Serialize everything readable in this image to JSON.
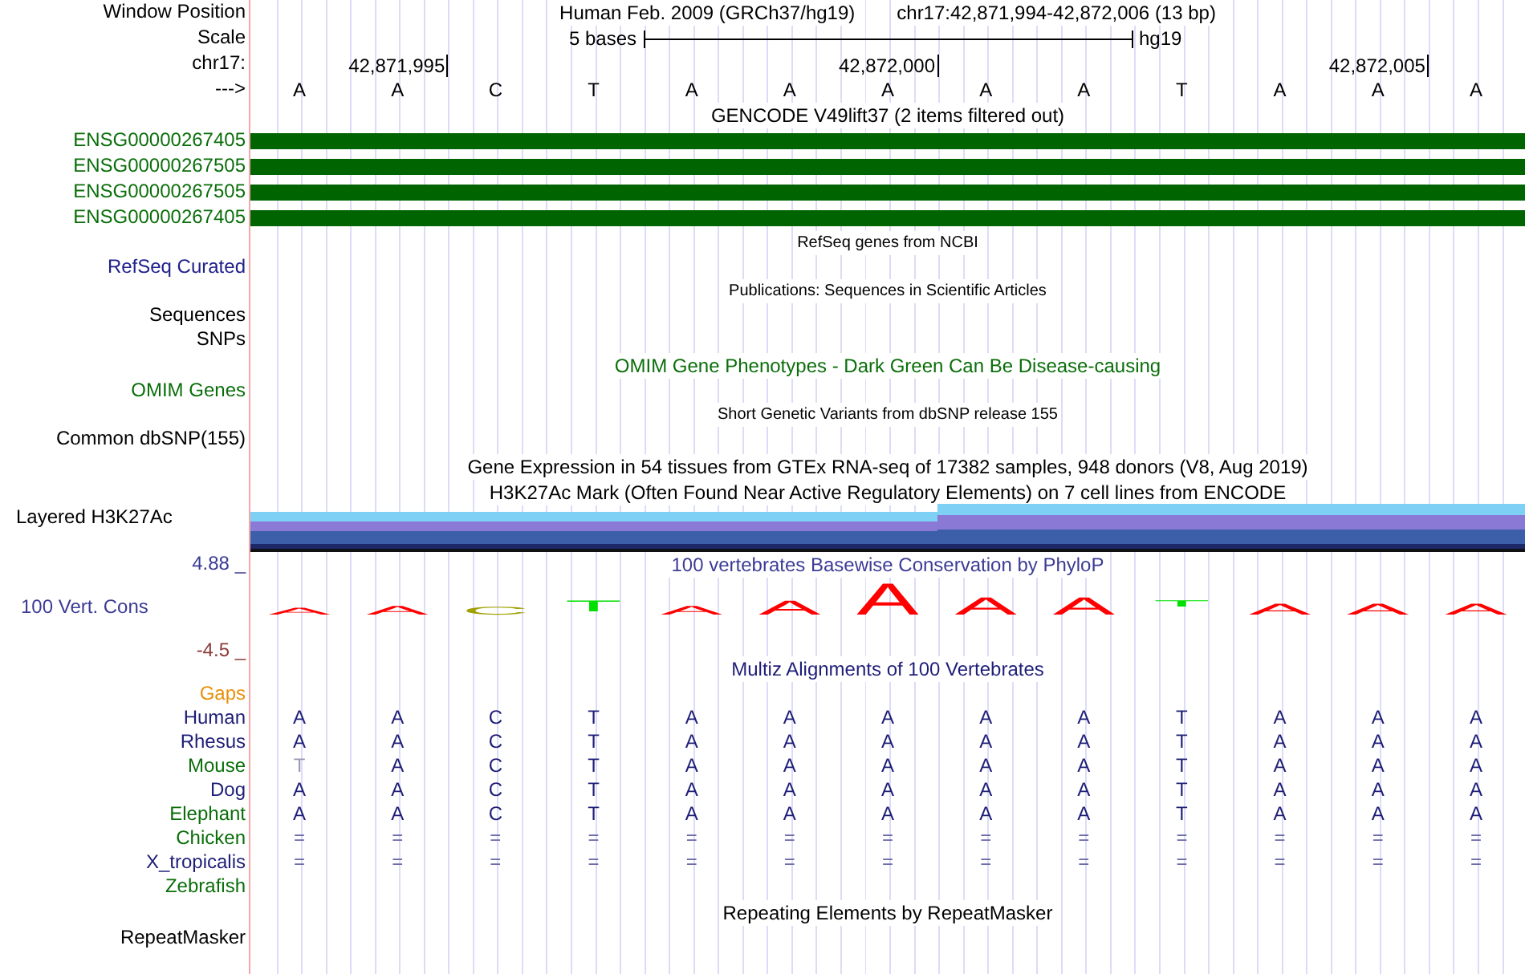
{
  "window_position": {
    "label": "Window Position",
    "assembly": "Human Feb. 2009 (GRCh37/hg19)",
    "position": "chr17:42,871,994-42,872,006 (13 bp)"
  },
  "scale": {
    "label": "Scale",
    "length": "5 bases",
    "assembly": "hg19"
  },
  "ruler": {
    "label": "chr17:",
    "ticks": [
      "42,871,995",
      "42,872,000",
      "42,872,005"
    ],
    "strand": "--->",
    "bases": [
      "A",
      "A",
      "C",
      "T",
      "A",
      "A",
      "A",
      "A",
      "A",
      "T",
      "A",
      "A",
      "A"
    ]
  },
  "tracks": [
    {
      "kind": "genes",
      "title": "GENCODE V49lift37 (2 items filtered out)",
      "color": "#000000",
      "items": [
        {
          "name": "ENSG00000267405"
        },
        {
          "name": "ENSG00000267505"
        },
        {
          "name": "ENSG00000267505"
        },
        {
          "name": "ENSG00000267405"
        }
      ]
    },
    {
      "kind": "compact",
      "title": "RefSeq genes from NCBI",
      "color": "#000000",
      "labels": [
        {
          "text": "RefSeq Curated",
          "color": "#20208c"
        }
      ]
    },
    {
      "kind": "compact",
      "title": "Publications: Sequences in Scientific Articles",
      "color": "#000000",
      "labels": [
        {
          "text": "Sequences",
          "color": "#000000"
        },
        {
          "text": "SNPs",
          "color": "#000000"
        }
      ]
    },
    {
      "kind": "track",
      "title": "OMIM Gene Phenotypes - Dark Green Can Be Disease-causing",
      "color": "#0a6e0a",
      "labels": [
        {
          "text": "OMIM Genes",
          "color": "#0a6e0a"
        }
      ]
    },
    {
      "kind": "compact",
      "title": "Short Genetic Variants from dbSNP release 155",
      "color": "#000000",
      "labels": [
        {
          "text": "Common dbSNP(155)",
          "color": "#000000"
        }
      ]
    },
    {
      "kind": "title",
      "title": "Gene Expression in 54 tissues from GTEx RNA-seq of 17382 samples, 948 donors (V8, Aug 2019)",
      "color": "#000000"
    },
    {
      "kind": "layered",
      "title": "H3K27Ac Mark (Often Found Near Active Regulatory Elements) on 7 cell lines from ENCODE",
      "color": "#000000",
      "label": "Layered H3K27Ac"
    },
    {
      "kind": "conservation",
      "title": "100 vertebrates Basewise Conservation by PhyloP",
      "color": "#3c3c96",
      "label": "100 Vert. Cons",
      "max": "4.88 _",
      "min": "-4.5 _",
      "logo": [
        {
          "letter": "A",
          "color": "#ff0000"
        },
        {
          "letter": "A",
          "color": "#ff0000"
        },
        {
          "letter": "C",
          "color": "#a0a000"
        },
        {
          "letter": "T",
          "color": "#00e000"
        },
        {
          "letter": "A",
          "color": "#ff0000"
        },
        {
          "letter": "A",
          "color": "#ff0000"
        },
        {
          "letter": "A",
          "color": "#ff0000"
        },
        {
          "letter": "A",
          "color": "#ff0000"
        },
        {
          "letter": "A",
          "color": "#ff0000"
        },
        {
          "letter": "T",
          "color": "#00e000"
        },
        {
          "letter": "A",
          "color": "#ff0000"
        },
        {
          "letter": "A",
          "color": "#ff0000"
        },
        {
          "letter": "A",
          "color": "#ff0000"
        }
      ]
    },
    {
      "kind": "alignment",
      "title": "Multiz Alignments of 100 Vertebrates",
      "color": "#1e1e78",
      "rows": [
        {
          "name": "Gaps",
          "color": "#e8900a",
          "kind": "label"
        },
        {
          "name": "Human",
          "color": "#1e1e78",
          "kind": "bases",
          "bases": [
            "A",
            "A",
            "C",
            "T",
            "A",
            "A",
            "A",
            "A",
            "A",
            "T",
            "A",
            "A",
            "A"
          ]
        },
        {
          "name": "Rhesus",
          "color": "#1e1e78",
          "kind": "bases",
          "bases": [
            "A",
            "A",
            "C",
            "T",
            "A",
            "A",
            "A",
            "A",
            "A",
            "T",
            "A",
            "A",
            "A"
          ]
        },
        {
          "name": "Mouse",
          "color": "#0a6e0a",
          "kind": "bases",
          "bases": [
            "T",
            "A",
            "C",
            "T",
            "A",
            "A",
            "A",
            "A",
            "A",
            "T",
            "A",
            "A",
            "A"
          ],
          "dimmed": [
            true,
            false,
            false,
            false,
            false,
            false,
            false,
            false,
            false,
            false,
            false,
            false,
            false
          ]
        },
        {
          "name": "Dog",
          "color": "#1e1e78",
          "kind": "bases",
          "bases": [
            "A",
            "A",
            "C",
            "T",
            "A",
            "A",
            "A",
            "A",
            "A",
            "T",
            "A",
            "A",
            "A"
          ]
        },
        {
          "name": "Elephant",
          "color": "#0a6e0a",
          "kind": "bases",
          "bases": [
            "A",
            "A",
            "C",
            "T",
            "A",
            "A",
            "A",
            "A",
            "A",
            "T",
            "A",
            "A",
            "A"
          ]
        },
        {
          "name": "Chicken",
          "color": "#0a6e0a",
          "kind": "gaps",
          "bases": [
            "=",
            "=",
            "=",
            "=",
            "=",
            "=",
            "=",
            "=",
            "=",
            "=",
            "=",
            "=",
            "="
          ]
        },
        {
          "name": "X_tropicalis",
          "color": "#1e1e78",
          "kind": "gaps",
          "bases": [
            "=",
            "=",
            "=",
            "=",
            "=",
            "=",
            "=",
            "=",
            "=",
            "=",
            "=",
            "=",
            "="
          ]
        },
        {
          "name": "Zebrafish",
          "color": "#0a6e0a",
          "kind": "label"
        }
      ]
    },
    {
      "kind": "track",
      "title": "Repeating Elements by RepeatMasker",
      "color": "#000000",
      "labels": [
        {
          "text": "RepeatMasker",
          "color": "#000000"
        }
      ]
    }
  ]
}
